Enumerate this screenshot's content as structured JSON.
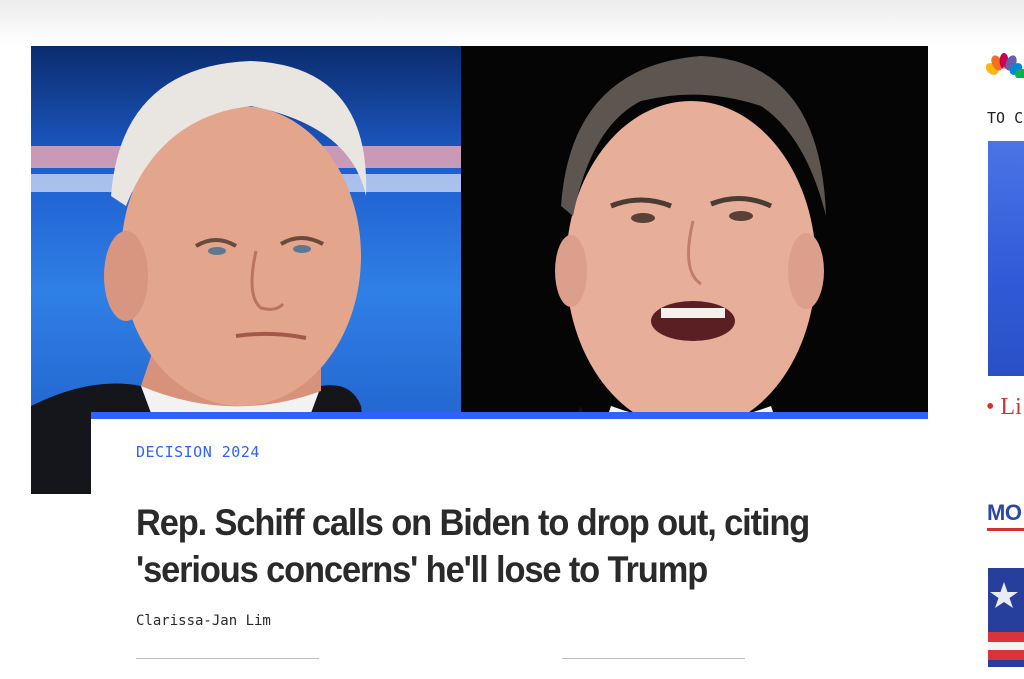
{
  "article": {
    "category": "DECISION 2024",
    "headline": "Rep. Schiff calls on Biden to drop out, citing 'serious concerns' he'll lose to Trump",
    "byline": "Clarissa-Jan Lim"
  },
  "hero_image": {
    "left_subject": "photo-of-joe-biden",
    "right_subject": "photo-of-adam-schiff"
  },
  "right_rail": {
    "logo": "nbc-peacock-icon",
    "section_label": "TO C",
    "live_label": "• Li",
    "more_heading": "MO"
  },
  "colors": {
    "accent_blue": "#3061ff",
    "headline_text": "#2a2a2a",
    "live_red": "#d62f2f",
    "rail_heading_blue": "#2b49a8"
  }
}
